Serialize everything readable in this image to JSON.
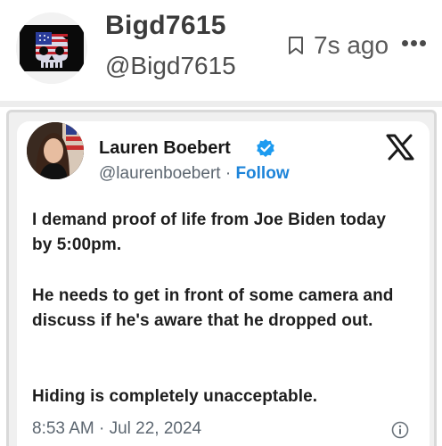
{
  "post": {
    "author_name": "Bigd7615",
    "author_handle": "@Bigd7615",
    "time_ago": "7s ago"
  },
  "tweet": {
    "author_name": "Lauren Boebert",
    "author_handle": "@laurenboebert",
    "separator": "·",
    "follow_label": "Follow",
    "paragraphs": [
      "I demand proof of life from Joe Biden today by 5:00pm.",
      "He needs to get in front of some camera and discuss if he's aware that he dropped out.",
      "Hiding is completely unacceptable."
    ],
    "timestamp": "8:53 AM · Jul 22, 2024"
  },
  "icons": {
    "bookmark": "bookmark-icon",
    "more": "more-horizontal-icon",
    "verified": "verified-badge-icon",
    "x_logo": "x-logo-icon",
    "info": "info-icon"
  },
  "colors": {
    "follow": "#1d84d9",
    "verified": "#1d9bf0",
    "divider": "#ededed"
  }
}
